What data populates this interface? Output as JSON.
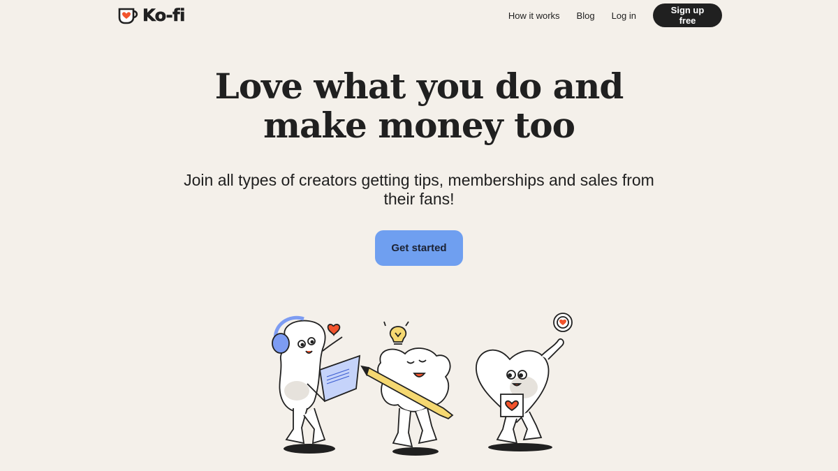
{
  "header": {
    "logo_text": "Ko-fi",
    "nav": [
      {
        "label": "How it works"
      },
      {
        "label": "Blog"
      },
      {
        "label": "Log in"
      }
    ],
    "signup_label": "Sign up free"
  },
  "hero": {
    "title_line1": "Love what you do and",
    "title_line2": "make money too",
    "subtitle_line1": "Join all types of creators getting tips, memberships and sales from",
    "subtitle_line2": "their fans!",
    "cta_label": "Get started"
  },
  "colors": {
    "background": "#f4f0ea",
    "dark": "#202020",
    "cta": "#6f9ff0",
    "accent_red": "#f2542d",
    "headphone_blue": "#7d9cf2",
    "pencil_yellow": "#f5d871"
  },
  "illustration": {
    "characters": [
      "creator-with-laptop",
      "creator-with-pencil",
      "creator-with-mug"
    ]
  }
}
